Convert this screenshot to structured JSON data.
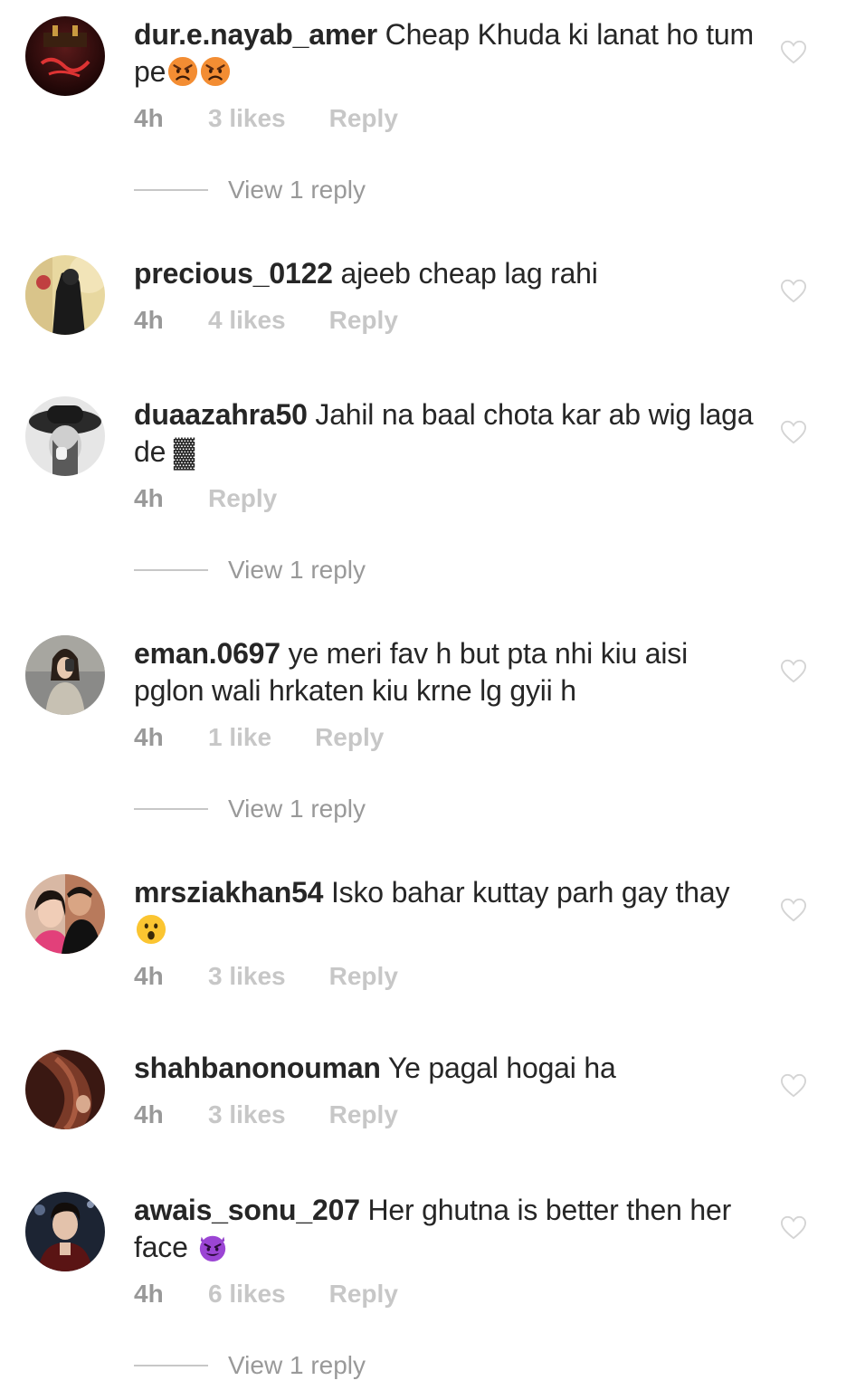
{
  "comments": [
    {
      "username": "dur.e.nayab_amer",
      "text": "Cheap Khuda ki lanat ho tum pe",
      "emoji": [
        "angry-face",
        "angry-face"
      ],
      "time": "4h",
      "likes": "3 likes",
      "reply": "Reply",
      "view_replies": "View 1 reply"
    },
    {
      "username": "precious_0122",
      "text": "ajeeb cheap lag rahi",
      "time": "4h",
      "likes": "4 likes",
      "reply": "Reply"
    },
    {
      "username": "duaazahra50",
      "text": "Jahil na baal chota kar ab wig laga de ▓",
      "time": "4h",
      "reply": "Reply",
      "view_replies": "View 1 reply"
    },
    {
      "username": "eman.0697",
      "text": "ye meri fav h but pta nhi kiu aisi pglon wali hrkaten kiu krne lg gyii h",
      "time": "4h",
      "likes": "1 like",
      "reply": "Reply",
      "view_replies": "View 1 reply"
    },
    {
      "username": "mrsziakhan54",
      "text": "Isko bahar kuttay parh gay thay",
      "emoji": [
        "surprised-face"
      ],
      "time": "4h",
      "likes": "3 likes",
      "reply": "Reply"
    },
    {
      "username": "shahbanonouman",
      "text": "Ye pagal hogai ha",
      "time": "4h",
      "likes": "3 likes",
      "reply": "Reply"
    },
    {
      "username": "awais_sonu_207",
      "text": "Her ghutna is better then her face",
      "emoji": [
        "devil-face"
      ],
      "time": "4h",
      "likes": "6 likes",
      "reply": "Reply",
      "view_replies": "View 1 reply"
    }
  ],
  "colors": {
    "text_primary": "#262626",
    "meta_grey": "#999999",
    "meta_light": "#c7c7c7",
    "emoji_orange": "#f28c28",
    "devil_purple": "#8e3bc7",
    "emoji_yellow": "#fbc531"
  }
}
